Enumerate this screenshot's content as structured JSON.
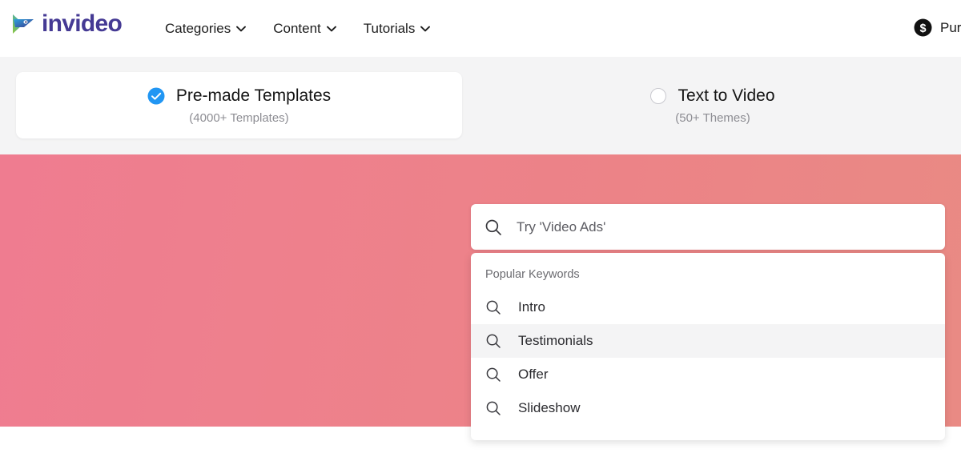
{
  "brand": {
    "name": "invideo",
    "logo_icon": "play-arrow-logo-icon",
    "logo_color": "#453a94"
  },
  "header": {
    "nav": [
      {
        "label": "Categories",
        "icon": "chevron-down-icon"
      },
      {
        "label": "Content",
        "icon": "chevron-down-icon"
      },
      {
        "label": "Tutorials",
        "icon": "chevron-down-icon"
      }
    ],
    "purchase": {
      "label": "Purchase",
      "icon": "dollar-coin-icon"
    }
  },
  "mode_toggle": {
    "options": [
      {
        "title": "Pre-made Templates",
        "subtitle": "(4000+ Templates)",
        "selected": true,
        "icon": "check-circle-icon"
      },
      {
        "title": "Text to Video",
        "subtitle": "(50+ Themes)",
        "selected": false,
        "icon": "radio-empty-icon"
      }
    ],
    "selected_accent": "#2196f3",
    "strip_background": "#f4f4f5"
  },
  "hero": {
    "background_start": "#ef7c90",
    "background_end": "#e98a84"
  },
  "search": {
    "placeholder": "Try 'Video Ads'",
    "value": "",
    "icon": "search-icon"
  },
  "suggestions": {
    "heading": "Popular Keywords",
    "items": [
      {
        "label": "Intro",
        "icon": "search-icon",
        "active": false
      },
      {
        "label": "Testimonials",
        "icon": "search-icon",
        "active": true
      },
      {
        "label": "Offer",
        "icon": "search-icon",
        "active": false
      },
      {
        "label": "Slideshow",
        "icon": "search-icon",
        "active": false
      }
    ],
    "highlight_color": "#f4f4f5"
  }
}
